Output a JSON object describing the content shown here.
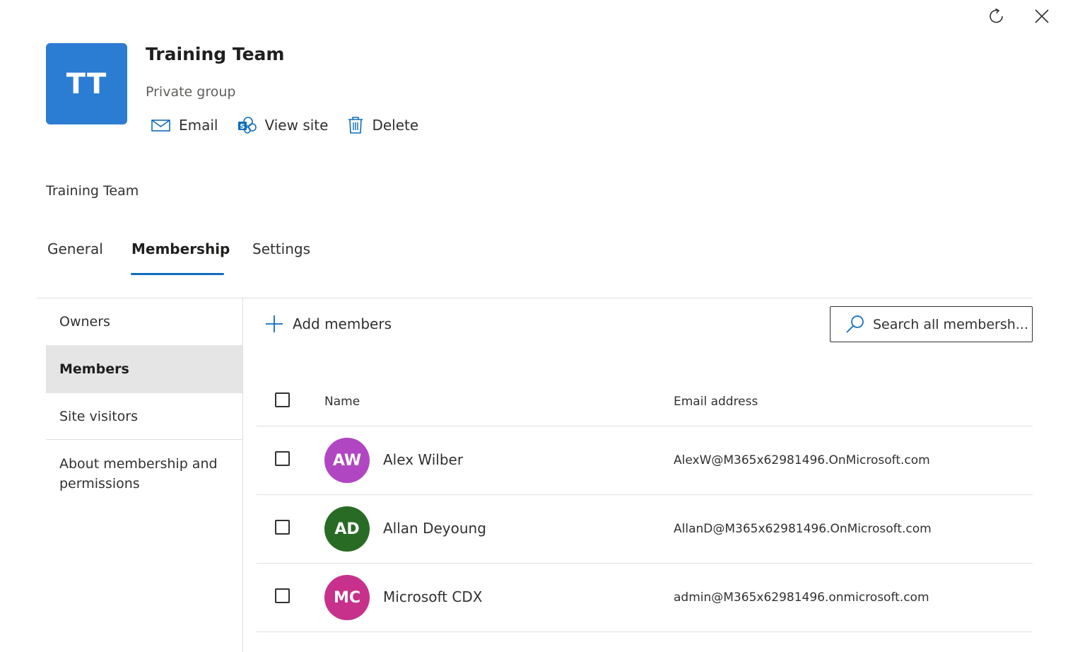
{
  "window": {
    "refresh_icon": "refresh-icon",
    "close_icon": "close-icon"
  },
  "group": {
    "initials": "TT",
    "tile_color": "#2b7cd3",
    "name": "Training Team",
    "type": "Private group"
  },
  "actions": [
    {
      "label": "Email",
      "icon": "mail-icon"
    },
    {
      "label": "View site",
      "icon": "sharepoint-icon"
    },
    {
      "label": "Delete",
      "icon": "trash-icon"
    }
  ],
  "breadcrumb": "Training Team",
  "tabs": [
    {
      "label": "General",
      "active": false
    },
    {
      "label": "Membership",
      "active": true
    },
    {
      "label": "Settings",
      "active": false
    }
  ],
  "subnav": [
    {
      "label": "Owners",
      "selected": false
    },
    {
      "label": "Members",
      "selected": true
    },
    {
      "label": "Site visitors",
      "selected": false
    },
    {
      "label": "About membership and permissions",
      "selected": false
    }
  ],
  "toolbar": {
    "add_label": "Add members",
    "search_placeholder": "Search all membersh..."
  },
  "table": {
    "columns": [
      "Name",
      "Email address"
    ],
    "rows": [
      {
        "initials": "AW",
        "avatar_color": "#b146c2",
        "name": "Alex Wilber",
        "email": "AlexW@M365x62981496.OnMicrosoft.com"
      },
      {
        "initials": "AD",
        "avatar_color": "#286b25",
        "name": "Allan Deyoung",
        "email": "AllanD@M365x62981496.OnMicrosoft.com"
      },
      {
        "initials": "MC",
        "avatar_color": "#c7308b",
        "name": "Microsoft CDX",
        "email": "admin@M365x62981496.onmicrosoft.com"
      }
    ]
  },
  "accent_color": "#0f6cbd"
}
